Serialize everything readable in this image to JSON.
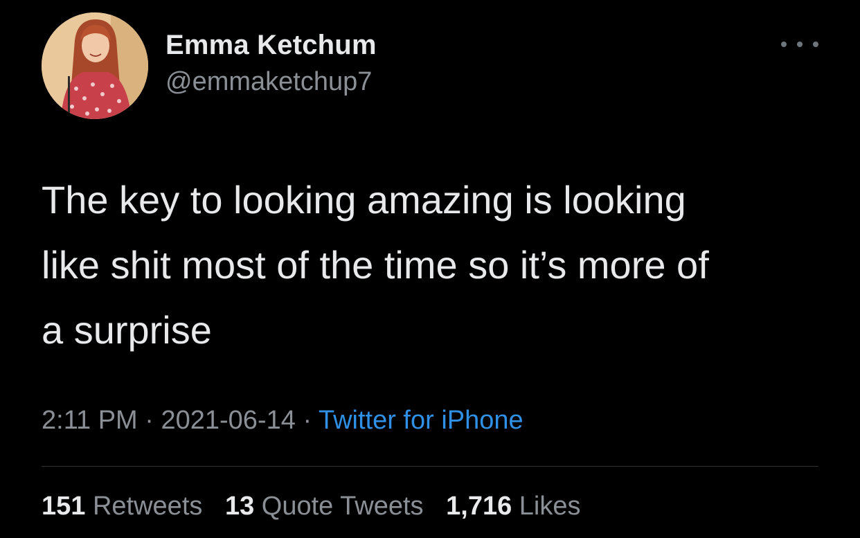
{
  "author": {
    "display_name": "Emma Ketchum",
    "handle": "@emmaketchup7",
    "avatar_icon": "profile-photo"
  },
  "menu": {
    "icon": "more-options-icon"
  },
  "tweet": {
    "lines": [
      "The key to looking amazing is looking",
      "like shit most of the time so it’s more of",
      "a surprise"
    ]
  },
  "meta": {
    "time": "2:11 PM",
    "separator": "·",
    "date": "2021-06-14",
    "source": "Twitter for iPhone"
  },
  "stats": {
    "retweets_count": "151",
    "retweets_label": "Retweets",
    "quotes_count": "13",
    "quotes_label": "Quote Tweets",
    "likes_count": "1,716",
    "likes_label": "Likes"
  },
  "colors": {
    "background": "#000000",
    "text": "#e7e9ea",
    "secondary": "#8b9096",
    "link": "#2f90e6"
  }
}
